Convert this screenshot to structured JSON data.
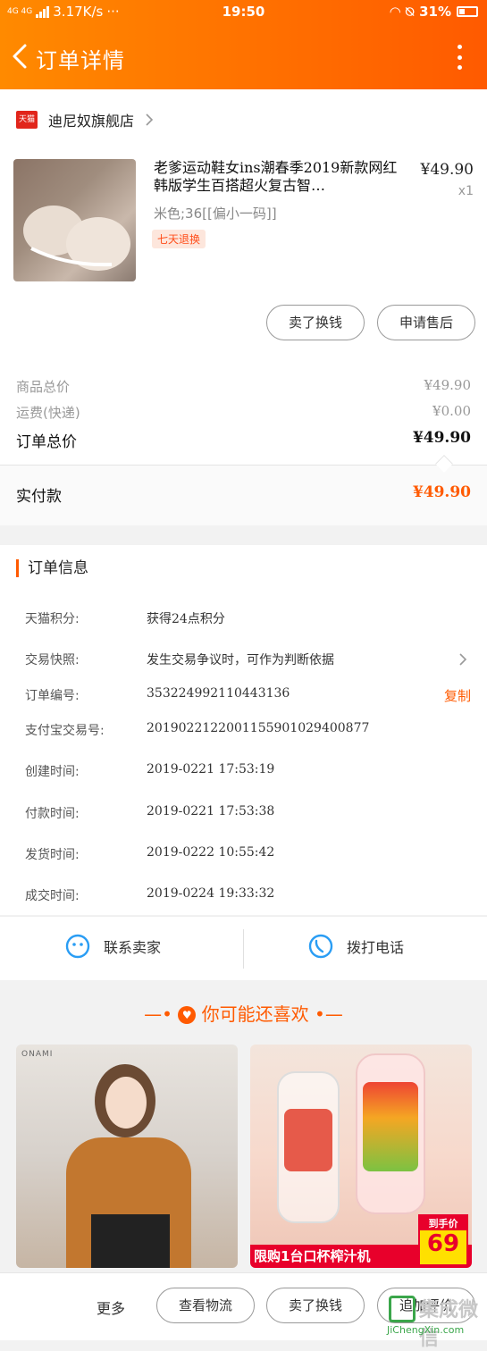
{
  "status_bar": {
    "network": "4G 4G",
    "speed": "3.17K/s",
    "dots": "···",
    "time": "19:50",
    "battery": "31%"
  },
  "header": {
    "title": "订单详情"
  },
  "shop": {
    "badge": "天猫",
    "name": "迪尼奴旗舰店"
  },
  "product": {
    "title": "老爹运动鞋女ins潮春季2019新款网红韩版学生百搭超火复古智…",
    "price": "¥49.90",
    "quantity": "x1",
    "sku": "米色;36[[偏小一码]]",
    "tag": "七天退换"
  },
  "actions": {
    "sell_button": "卖了换钱",
    "after_sale_button": "申请售后"
  },
  "summary": {
    "goods_total_label": "商品总价",
    "goods_total_value": "¥49.90",
    "shipping_label": "运费(快递)",
    "shipping_value": "¥0.00",
    "order_total_label": "订单总价",
    "order_total_value": "¥49.90",
    "paid_label": "实付款",
    "paid_value": "¥49.90"
  },
  "order_info": {
    "title": "订单信息",
    "rows": [
      {
        "key": "天猫积分:",
        "value": "获得24点积分"
      },
      {
        "key": "交易快照:",
        "value": "发生交易争议时，可作为判断依据"
      },
      {
        "key": "订单编号:",
        "value": "353224992110443136"
      },
      {
        "key": "支付宝交易号:",
        "value": "2019022122001155901029400877"
      },
      {
        "key": "创建时间:",
        "value": "2019-0221 17:53:19"
      },
      {
        "key": "付款时间:",
        "value": "2019-0221 17:53:38"
      },
      {
        "key": "发货时间:",
        "value": "2019-0222 10:55:42"
      },
      {
        "key": "成交时间:",
        "value": "2019-0224 19:33:32"
      }
    ],
    "copy_label": "复制"
  },
  "contact": {
    "seller": "联系卖家",
    "call": "拨打电话"
  },
  "recommend": {
    "title": "你可能还喜欢",
    "left_brand": "ONAMI",
    "right_promo": "限购1台口杯榨汁机",
    "right_tag_label": "到手价",
    "right_tag_price": "69"
  },
  "bottom": {
    "more": "更多",
    "logistics": "查看物流",
    "sell": "卖了换钱",
    "review": "追加评价"
  },
  "watermark": {
    "text": "集成微信",
    "url": "JiChengXin.com"
  },
  "colors": {
    "accent": "#ff5a00",
    "header_start": "#ff8a00",
    "tmall_red": "#e1251b"
  }
}
